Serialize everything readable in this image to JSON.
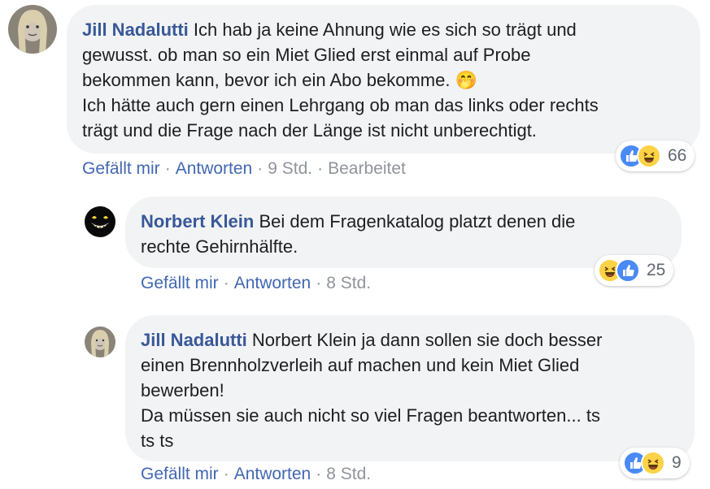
{
  "comments": [
    {
      "author": "Jill Nadalutti",
      "lines": [
        "Ich hab ja keine Ahnung wie es sich so trägt und",
        "gewusst. ob man so ein Miet Glied erst einmal auf Probe",
        "bekommen kann, bevor ich ein Abo bekomme. 🤭",
        "Ich hätte auch gern einen Lehrgang ob man das links oder rechts",
        "trägt und die Frage nach der Länge ist nicht unberechtigt."
      ],
      "actions": {
        "like": "Gefällt mir",
        "reply": "Antworten",
        "time": "9 Std.",
        "edited": "Bearbeitet"
      },
      "reactions": {
        "icons": [
          "like-icon",
          "haha-icon"
        ],
        "count": "66"
      }
    },
    {
      "author": "Norbert Klein",
      "lines": [
        "Bei dem Fragenkatalog platzt denen die",
        "rechte Gehirnhälfte."
      ],
      "actions": {
        "like": "Gefällt mir",
        "reply": "Antworten",
        "time": "8 Std."
      },
      "reactions": {
        "icons": [
          "haha-icon",
          "like-icon"
        ],
        "count": "25"
      }
    },
    {
      "author": "Jill Nadalutti",
      "lines": [
        "Norbert Klein ja dann sollen sie doch besser",
        "einen Brennholzverleih auf machen und kein Miet Glied",
        "bewerben!",
        "Da müssen sie auch nicht so viel Fragen beantworten... ts",
        "ts ts"
      ],
      "actions": {
        "like": "Gefällt mir",
        "reply": "Antworten",
        "time": "8 Std."
      },
      "reactions": {
        "icons": [
          "like-icon",
          "haha-icon"
        ],
        "count": "9"
      }
    }
  ],
  "separator": "·",
  "colors": {
    "author": "#385898",
    "link": "#4267b2",
    "bubble": "#f2f3f5",
    "meta": "#90949c",
    "like": "#4a8af4",
    "haha": "#fcd246"
  }
}
